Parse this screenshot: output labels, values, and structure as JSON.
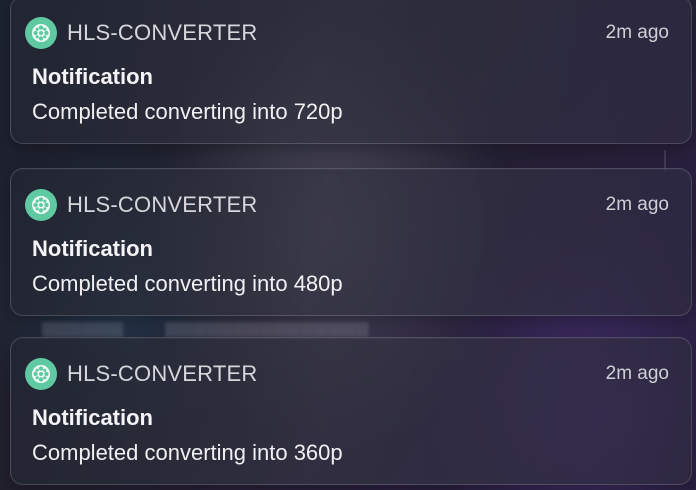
{
  "notifications": [
    {
      "app_name": "HLS-CONVERTER",
      "app_icon": "film-reel-icon",
      "time": "2m ago",
      "title": "Notification",
      "message": "Completed converting into 720p"
    },
    {
      "app_name": "HLS-CONVERTER",
      "app_icon": "film-reel-icon",
      "time": "2m ago",
      "title": "Notification",
      "message": "Completed converting into 480p"
    },
    {
      "app_name": "HLS-CONVERTER",
      "app_icon": "film-reel-icon",
      "time": "2m ago",
      "title": "Notification",
      "message": "Completed converting into 360p"
    }
  ],
  "colors": {
    "icon_background": "#5fc9a2"
  }
}
